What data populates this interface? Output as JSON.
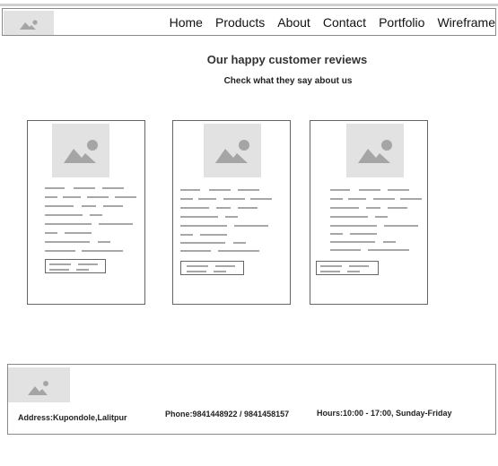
{
  "nav": {
    "logo_icon": "image-placeholder-icon",
    "links": [
      "Home",
      "Products",
      "About",
      "Contact",
      "Portfolio",
      "Wireframe"
    ]
  },
  "reviews": {
    "heading": "Our happy customer reviews",
    "subheading": "Check what they say about us"
  },
  "cards": [
    {
      "image_icon": "image-placeholder-icon"
    },
    {
      "image_icon": "image-placeholder-icon"
    },
    {
      "image_icon": "image-placeholder-icon"
    }
  ],
  "footer": {
    "logo_icon": "image-placeholder-icon",
    "address": "Address:Kupondole,Lalitpur",
    "phone": "Phone:9841448922 / 9841458157",
    "hours": "Hours:10:00 - 17:00, Sunday-Friday"
  }
}
